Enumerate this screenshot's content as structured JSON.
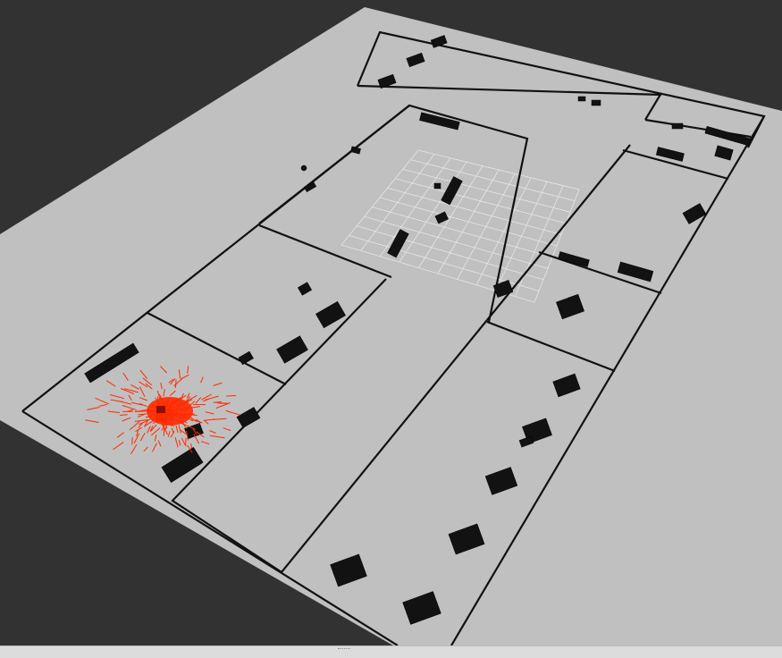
{
  "app": {
    "view": "3d-map-viewport"
  },
  "colors": {
    "background": "#323232",
    "ground": "#c0c0c0",
    "walls": "#111111",
    "obstacles": "#121212",
    "grid": "#e6e6e6",
    "particles": "#ff2a00",
    "status_bar": "#dcdcdc"
  },
  "scene": {
    "grid": {
      "visible": true,
      "cells": 10
    },
    "particle_cloud": {
      "visible": true,
      "count": 220
    }
  }
}
